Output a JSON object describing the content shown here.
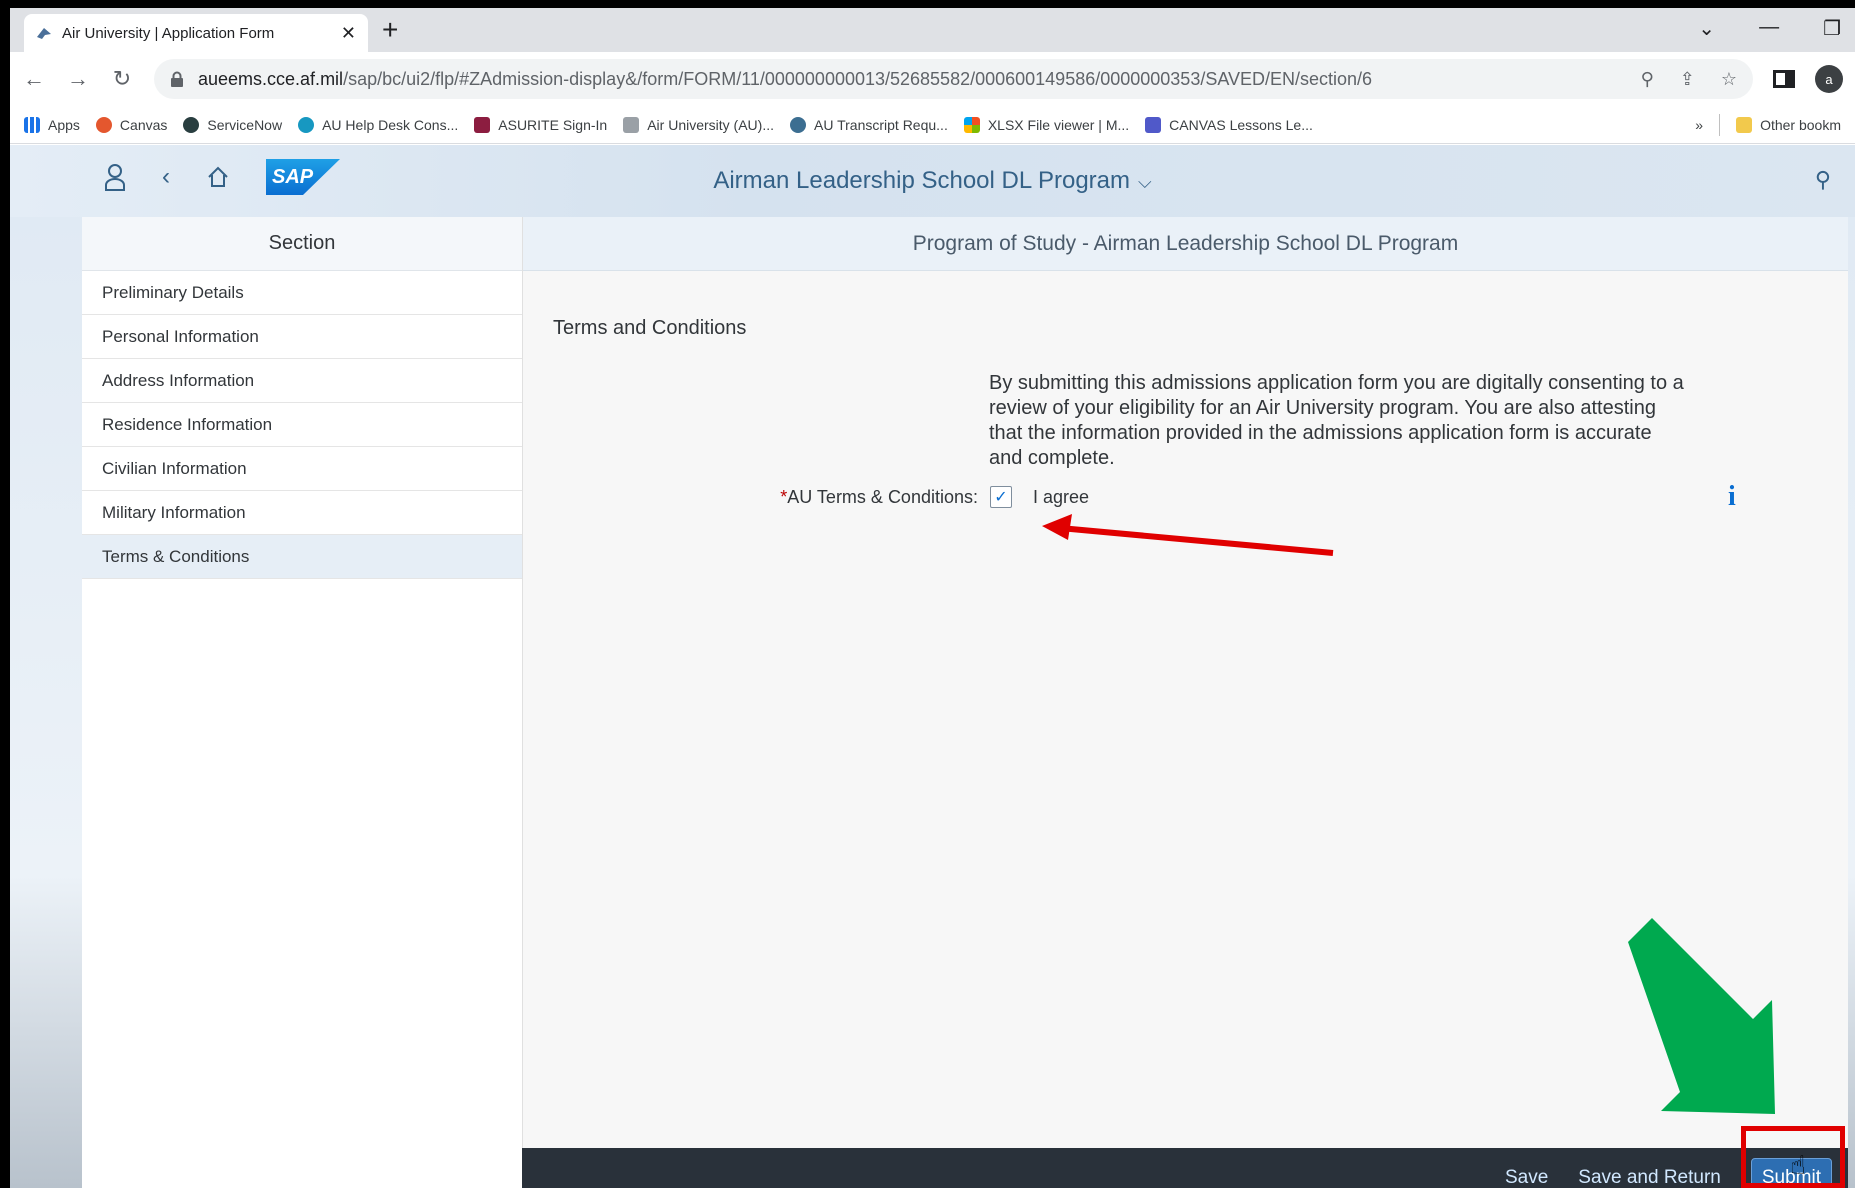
{
  "browser": {
    "tab_title": "Air University | Application Form",
    "tab_close": "✕",
    "new_tab": "+",
    "url_host": "aueems.cce.af.mil",
    "url_path": "/sap/bc/ui2/flp/#ZAdmission-display&/form/FORM/11/000000000013/52685582/000600149586/0000000353/SAVED/EN/section/6",
    "profile_initial": "a",
    "bookmarks": [
      "Apps",
      "Canvas",
      "ServiceNow",
      "AU Help Desk Cons...",
      "ASURITE Sign-In",
      "Air University (AU)...",
      "AU Transcript Requ...",
      "XLSX File viewer | M...",
      "CANVAS Lessons Le..."
    ],
    "more_bookmarks": "»",
    "other_bookmarks": "Other bookm"
  },
  "shell": {
    "logo_text": "SAP",
    "app_title": "Airman Leadership School DL Program",
    "title_chevron": "⌵"
  },
  "sections": {
    "header": "Section",
    "items": [
      "Preliminary Details",
      "Personal Information",
      "Address Information",
      "Residence Information",
      "Civilian Information",
      "Military Information",
      "Terms & Conditions"
    ],
    "selected_index": 6
  },
  "form": {
    "header": "Program of Study - Airman Leadership School DL Program",
    "title": "Terms and Conditions",
    "terms_text": "By submitting this admissions application form you are digitally consenting to a review of your eligibility for an Air University program. You are also attesting that the information provided in the admissions application form is accurate and complete.",
    "required_marker": "*",
    "field_label": "AU Terms & Conditions:",
    "checkbox_checked": true,
    "checkbox_glyph": "✓",
    "checkbox_text": "I agree",
    "info_glyph": "i"
  },
  "footer": {
    "save": "Save",
    "save_return": "Save and Return",
    "submit": "Submit"
  },
  "annotation_colors": {
    "red_arrow": "#e00000",
    "green_arrow": "#00a94f",
    "highlight_box": "#e00000"
  }
}
